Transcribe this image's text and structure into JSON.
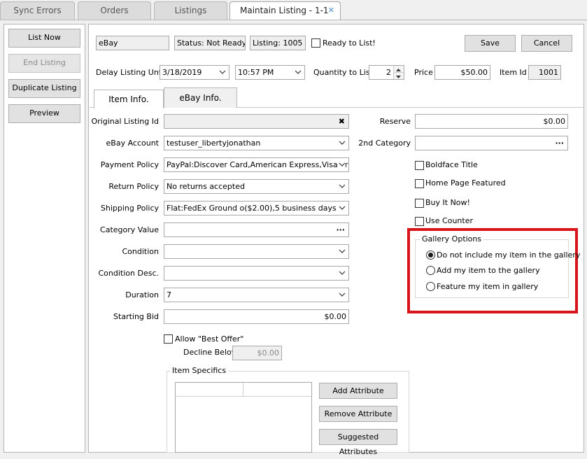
{
  "tabs": [
    {
      "label": "Sync Errors"
    },
    {
      "label": "Orders"
    },
    {
      "label": "Listings"
    },
    {
      "label": "Maintain Listing - 1-1",
      "close": "✕"
    }
  ],
  "sidebar": {
    "list_now": "List Now",
    "end_listing": "End Listing",
    "duplicate_listing": "Duplicate Listing",
    "preview": "Preview"
  },
  "header": {
    "site": "eBay",
    "status": "Status: Not Ready",
    "listing": "Listing: 1005",
    "ready_label": "Ready to List!",
    "save": "Save",
    "cancel": "Cancel"
  },
  "row2": {
    "delay_label": "Delay Listing Until",
    "delay_date": "3/18/2019",
    "delay_time": "10:57 PM",
    "qty_label": "Quantity to List",
    "qty_value": "2",
    "price_label": "Price",
    "price_value": "$50.00",
    "itemid_label": "Item Id",
    "itemid_value": "1001"
  },
  "subtabs": {
    "item_info": "Item Info.",
    "ebay_info": "eBay Info."
  },
  "form": {
    "original_listing_id": {
      "label": "Original Listing Id",
      "value": ""
    },
    "ebay_account": {
      "label": "eBay Account",
      "value": "testuser_libertyjonathan"
    },
    "payment_policy": {
      "label": "Payment Policy",
      "value": "PayPal:Discover Card,American Express,Visa or"
    },
    "return_policy": {
      "label": "Return Policy",
      "value": "No returns accepted"
    },
    "shipping_policy": {
      "label": "Shipping Policy",
      "value": "Flat:FedEx Ground o($2.00),5 business days"
    },
    "category_value": {
      "label": "Category Value",
      "value": ""
    },
    "condition": {
      "label": "Condition",
      "value": ""
    },
    "condition_desc": {
      "label": "Condition Desc.",
      "value": ""
    },
    "duration": {
      "label": "Duration",
      "value": "7"
    },
    "starting_bid": {
      "label": "Starting Bid",
      "value": "$0.00"
    },
    "best_offer_label": "Allow \"Best Offer\"",
    "decline_below_label": "Decline Below",
    "decline_below_value": "$0.00"
  },
  "right": {
    "reserve_label": "Reserve",
    "reserve_value": "$0.00",
    "second_category_label": "2nd Category",
    "second_category_value": "",
    "boldface": "Boldface Title",
    "home_page": "Home Page Featured",
    "buy_it_now": "Buy It Now!",
    "use_counter": "Use Counter"
  },
  "gallery": {
    "title": "Gallery Options",
    "options": [
      {
        "label": "Do not include my item in the gallery",
        "selected": true
      },
      {
        "label": "Add my item to the gallery",
        "selected": false
      },
      {
        "label": "Feature my item in gallery",
        "selected": false
      }
    ],
    "highlight_color": "#d7141a"
  },
  "item_specifics": {
    "title": "Item Specifics",
    "add": "Add Attribute",
    "remove": "Remove Attribute",
    "suggested": "Suggested Attributes"
  },
  "icons": {
    "clear": "✖",
    "ellipsis": "···"
  }
}
